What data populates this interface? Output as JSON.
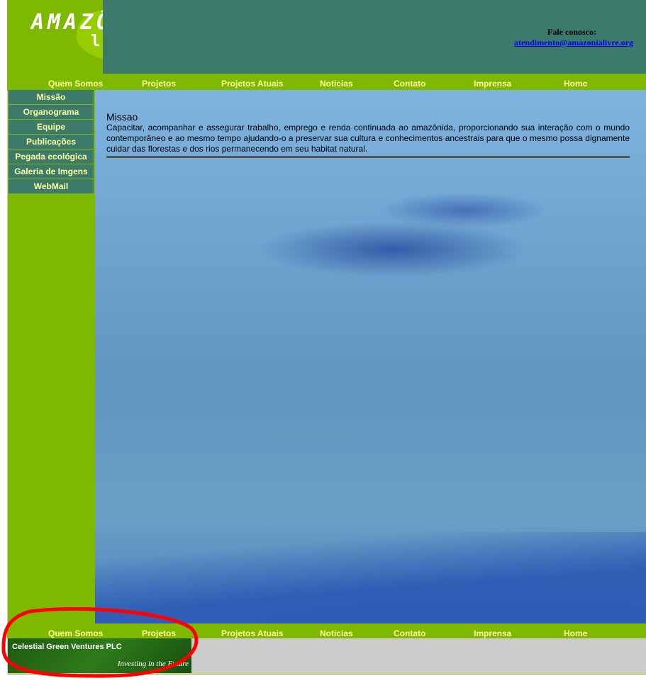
{
  "logo": {
    "title": "AMAZÔNIA",
    "subtitle": "livre"
  },
  "contact": {
    "label": "Fale conosco:",
    "email": "atendimento@amazonialivre.org"
  },
  "nav": [
    "Quem Somos",
    "Projetos",
    "Projetos Atuais",
    "Noticias",
    "Contato",
    "Imprensa",
    "Home"
  ],
  "sidebar": [
    "Missão",
    "Organograma",
    "Equipe",
    "Publicações",
    "Pegada ecológica",
    "Galeria de Imgens",
    "WebMail"
  ],
  "content": {
    "heading": "Missao",
    "body": "Capacitar, acompanhar e assegurar trabalho, emprego e renda continuada ao amazônida, proporcionando sua interação com o mundo contemporâneo e ao mesmo tempo ajudando-o a preservar sua cultura e conhecimentos ancestrais para que o mesmo possa dignamente cuidar das florestas e dos rios permanecendo em seu habitat natural."
  },
  "banner": {
    "name": "Celestial Green Ventures PLC",
    "tagline": "Investing in the Future"
  },
  "colors": {
    "green": "#7fb800",
    "teal": "#3c7a6c",
    "link": "#0000ee",
    "nav_text": "#ffff99",
    "annotation": "#ff0000"
  }
}
